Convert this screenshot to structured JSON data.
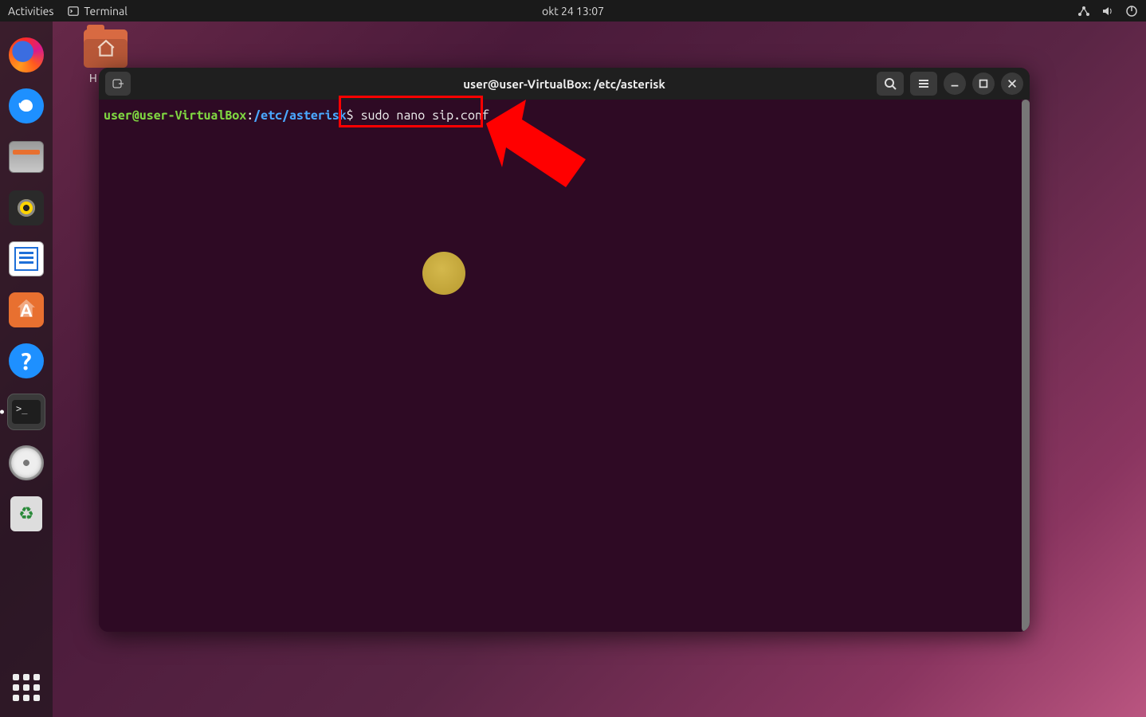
{
  "topbar": {
    "activities": "Activities",
    "app_name": "Terminal",
    "clock": "okt 24  13:07"
  },
  "dock": {
    "items": [
      {
        "name": "firefox",
        "label": "Firefox"
      },
      {
        "name": "thunderbird",
        "label": "Thunderbird"
      },
      {
        "name": "files",
        "label": "Files"
      },
      {
        "name": "rhythmbox",
        "label": "Rhythmbox"
      },
      {
        "name": "writer",
        "label": "LibreOffice Writer"
      },
      {
        "name": "software",
        "label": "Ubuntu Software"
      },
      {
        "name": "help",
        "label": "Help",
        "glyph": "?"
      },
      {
        "name": "terminal",
        "label": "Terminal",
        "prompt": ">_"
      },
      {
        "name": "disc",
        "label": "Disc"
      },
      {
        "name": "trash",
        "label": "Trash"
      }
    ]
  },
  "desktop": {
    "home_label_visible": "H"
  },
  "terminal": {
    "title": "user@user-VirtualBox: /etc/asterisk",
    "prompt_userhost": "user@user-VirtualBox",
    "prompt_sep": ":",
    "prompt_path": "/etc/asterisk",
    "prompt_symbol": "$",
    "command": " sudo nano sip.conf"
  },
  "annotations": {
    "highlight_box_color": "#ff0000",
    "arrow_color": "#ff0000",
    "cursor_dot_color": "#c9ad3e"
  }
}
